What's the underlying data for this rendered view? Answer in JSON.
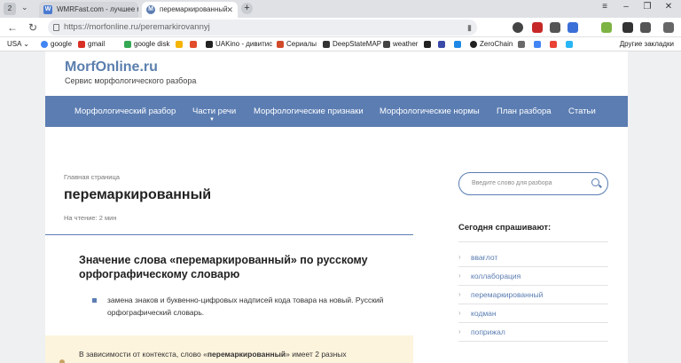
{
  "browser": {
    "tab_count": "2",
    "tabs": [
      {
        "label": "WMRFast.com - лучшее м",
        "icon": "wmrfast-favicon"
      },
      {
        "label": "перемаркированный",
        "icon": "morfonline-favicon"
      }
    ],
    "url": "https://morfonline.ru/peremarkirovannyj",
    "bookmarks": [
      {
        "label": "USA",
        "color": "#777777"
      },
      {
        "label": "google",
        "color": "#4285f4"
      },
      {
        "label": "gmail",
        "color": "#d93025"
      },
      {
        "label": "google disk",
        "color": "#34a853"
      },
      {
        "label": "",
        "color": "#f4b400"
      },
      {
        "label": "",
        "color": "#e24c2a"
      },
      {
        "label": "UAKino - дивитис",
        "color": "#222222"
      },
      {
        "label": "Сериалы",
        "color": "#d04a2a"
      },
      {
        "label": "DeepStateMAP",
        "color": "#333333"
      },
      {
        "label": "weather",
        "color": "#444444"
      }
    ],
    "bookmark_zero": "ZeroChain",
    "other_bookmarks": "Другие закладки"
  },
  "site": {
    "title": "MorfOnline.ru",
    "subtitle": "Сервис морфологического разбора",
    "nav": [
      "Морфологический разбор",
      "Части речи",
      "Морфологические признаки",
      "Морфологические нормы",
      "План разбора",
      "Статьи"
    ]
  },
  "article": {
    "breadcrumb": "Главная страница",
    "title": "перемаркированный",
    "read_time": "На чтение: 2 мин",
    "section_title": "Значение слова «перемаркированный» по русскому орфографическому словарю",
    "definition": "замена знаков и буквенно-цифровых надписей кода товара на новый. Русский орфографический словарь.",
    "note_prefix": "В зависимости от контекста, слово «",
    "note_word": "перемаркированный",
    "note_suffix": "» имеет 2 разных"
  },
  "sidebar": {
    "search_placeholder": "Введите слово для разбора",
    "popular_title": "Сегодня спрашивают:",
    "popular": [
      "ввағлот",
      "коллаборация",
      "перемаркированный",
      "кодман",
      "поприжал"
    ]
  },
  "colors": {
    "accent": "#5b7db2",
    "note_bg": "#fdf4dd"
  }
}
